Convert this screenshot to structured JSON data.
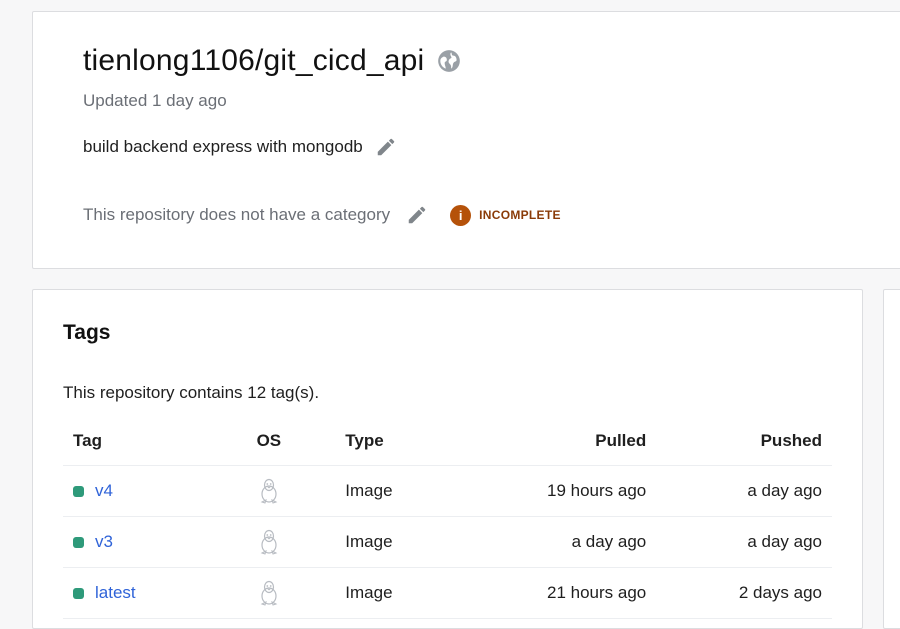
{
  "repo": {
    "title": "tienlong1106/git_cicd_api",
    "visibility_icon": "globe-icon",
    "updated": "Updated 1 day ago",
    "description": "build backend express with mongodb",
    "category": "This repository does not have a category",
    "badge_label": "INCOMPLETE",
    "badge_color": "#b5520a"
  },
  "tags": {
    "title": "Tags",
    "count_text": "This repository contains 12 tag(s).",
    "columns": [
      "Tag",
      "OS",
      "Type",
      "Pulled",
      "Pushed"
    ],
    "rows": [
      {
        "tag": "v4",
        "os_icon": "linux-tux-icon",
        "type": "Image",
        "pulled": "19 hours ago",
        "pushed": "a day ago"
      },
      {
        "tag": "v3",
        "os_icon": "linux-tux-icon",
        "type": "Image",
        "pulled": "a day ago",
        "pushed": "a day ago"
      },
      {
        "tag": "latest",
        "os_icon": "linux-tux-icon",
        "type": "Image",
        "pulled": "21 hours ago",
        "pushed": "2 days ago"
      }
    ],
    "status_color": "#2e9a7a",
    "link_color": "#2f63d8"
  }
}
